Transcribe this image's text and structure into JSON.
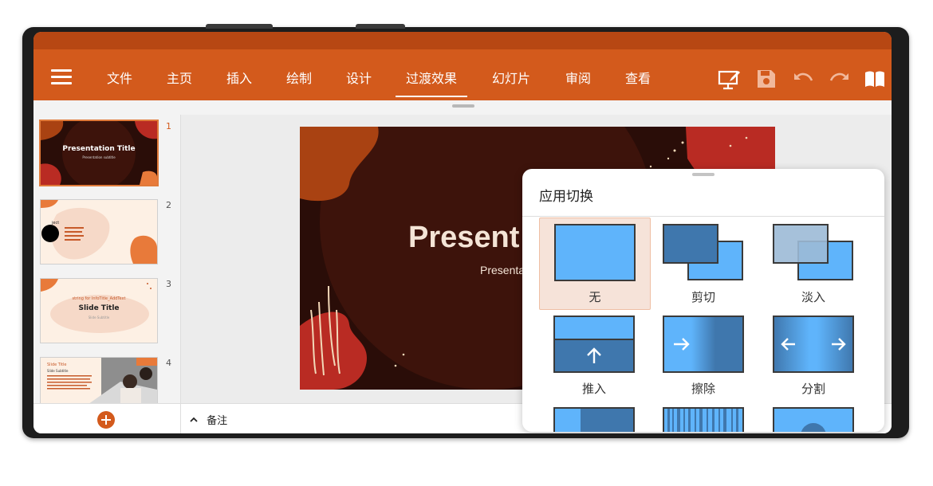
{
  "toolbar": {
    "tabs": [
      {
        "label": "文件"
      },
      {
        "label": "主页"
      },
      {
        "label": "插入"
      },
      {
        "label": "绘制"
      },
      {
        "label": "设计"
      },
      {
        "label": "过渡效果"
      },
      {
        "label": "幻灯片"
      },
      {
        "label": "审阅"
      },
      {
        "label": "查看"
      }
    ],
    "active_tab": "过渡效果",
    "tools": [
      "present-icon",
      "save-icon",
      "undo-icon",
      "redo-icon",
      "reading-view-icon"
    ]
  },
  "slides": [
    {
      "number": "1",
      "title": "Presentation Title",
      "subtitle": "Presentation subtitle"
    },
    {
      "number": "2",
      "title": "ject"
    },
    {
      "number": "3",
      "pretitle": "string for InfoTitle_AddText",
      "title": "Slide Title",
      "subtitle": "Slide Subtitle"
    },
    {
      "number": "4",
      "title": "Slide Title",
      "subtitle": "Slide Subtitle"
    }
  ],
  "main_slide": {
    "title": "Present",
    "subtitle": "Presenta"
  },
  "bottom": {
    "notes_label": "备注",
    "add_slide_icon": "plus-icon"
  },
  "transition_panel": {
    "title": "应用切换",
    "items": [
      {
        "label": "无"
      },
      {
        "label": "剪切"
      },
      {
        "label": "淡入"
      },
      {
        "label": "推入"
      },
      {
        "label": "擦除"
      },
      {
        "label": "分割"
      }
    ],
    "selected": "无"
  },
  "colors": {
    "accent": "#d35a1c",
    "accent_dark": "#b74713",
    "slide_background": "#2a0d08",
    "transition_light_blue": "#5fb4fb",
    "transition_dark_blue": "#3f77ad"
  }
}
